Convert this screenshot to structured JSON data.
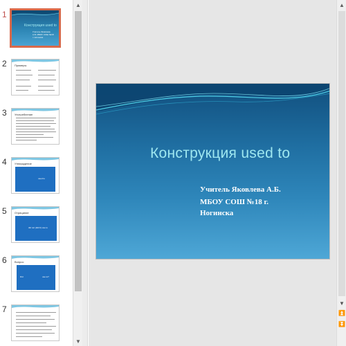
{
  "thumbnails": [
    {
      "number": "1",
      "title": "Конструкция used to",
      "subtitle": "Учитель Яковлева А.Б. МБОУ СОШ №18 г. Ногинска"
    },
    {
      "number": "2",
      "title": "Примеры"
    },
    {
      "number": "3",
      "title": "Употребление"
    },
    {
      "number": "4",
      "title": "Утверждение",
      "box_text": "used to"
    },
    {
      "number": "5",
      "title": "Отрицание",
      "box_text": "did not (didn't) use to"
    },
    {
      "number": "6",
      "title": "Вопрос",
      "box_text": "use to?",
      "box_left": "Did"
    },
    {
      "number": "7",
      "title": ""
    }
  ],
  "slide": {
    "title": "Конструкция used to",
    "subtitle_lines": [
      "Учитель Яковлева А.Б.",
      "МБОУ СОШ №18 г.",
      "Ногинска"
    ]
  },
  "colors": {
    "accent_selected": "#d9694a",
    "slide_title": "#9ee7f0"
  }
}
